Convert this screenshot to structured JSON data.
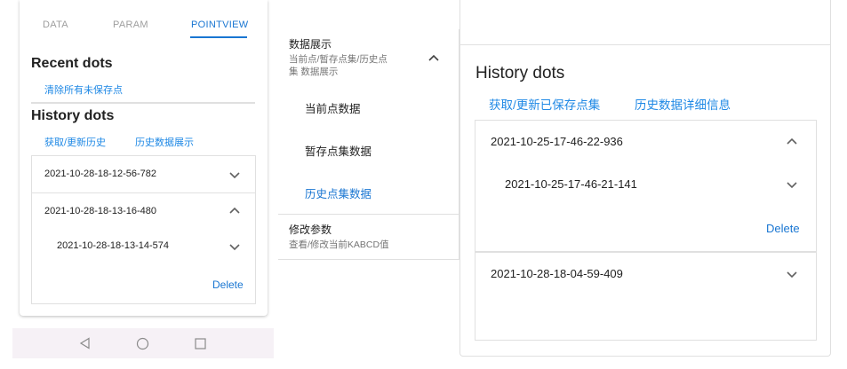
{
  "left": {
    "tabs": [
      {
        "label": "DATA",
        "active": false
      },
      {
        "label": "PARAM",
        "active": false
      },
      {
        "label": "POINTVIEW",
        "active": true
      }
    ],
    "recent": {
      "title": "Recent dots",
      "clear_label": "清除所有未保存点"
    },
    "history": {
      "title": "History dots",
      "fetch_label": "获取/更新历史",
      "show_label": "历史数据展示",
      "items": [
        {
          "label": "2021-10-28-18-12-56-782",
          "expanded": false
        },
        {
          "label": "2021-10-28-18-13-16-480",
          "expanded": true,
          "children": [
            {
              "label": "2021-10-28-18-13-14-574",
              "expanded": false
            }
          ],
          "delete_label": "Delete"
        }
      ]
    },
    "nav": {
      "back_icon": "back-triangle-icon",
      "home_icon": "home-circle-icon",
      "recents_icon": "recents-square-icon"
    }
  },
  "middle": {
    "group1": {
      "title": "数据展示",
      "subtitle_line1": "当前点/暂存点集/历史点",
      "subtitle_line2": "集 数据展示",
      "expanded": true
    },
    "items": [
      {
        "label": "当前点数据",
        "selected": false
      },
      {
        "label": "暂存点集数据",
        "selected": false
      },
      {
        "label": "历史点集数据",
        "selected": true
      }
    ],
    "group2": {
      "title": "修改参数",
      "subtitle": "查看/修改当前KABCD值"
    }
  },
  "right": {
    "title": "History dots",
    "fetch_label": "获取/更新已保存点集",
    "detail_label": "历史数据详细信息",
    "items": [
      {
        "label": "2021-10-25-17-46-22-936",
        "expanded": true,
        "children": [
          {
            "label": "2021-10-25-17-46-21-141",
            "expanded": false
          }
        ],
        "delete_label": "Delete"
      },
      {
        "label": "2021-10-28-18-04-59-409",
        "expanded": false
      }
    ]
  },
  "colors": {
    "accent": "#1976d2",
    "link": "#1e88e5",
    "nav_bg": "#f6f1f6",
    "divider": "#e0e0e0"
  }
}
